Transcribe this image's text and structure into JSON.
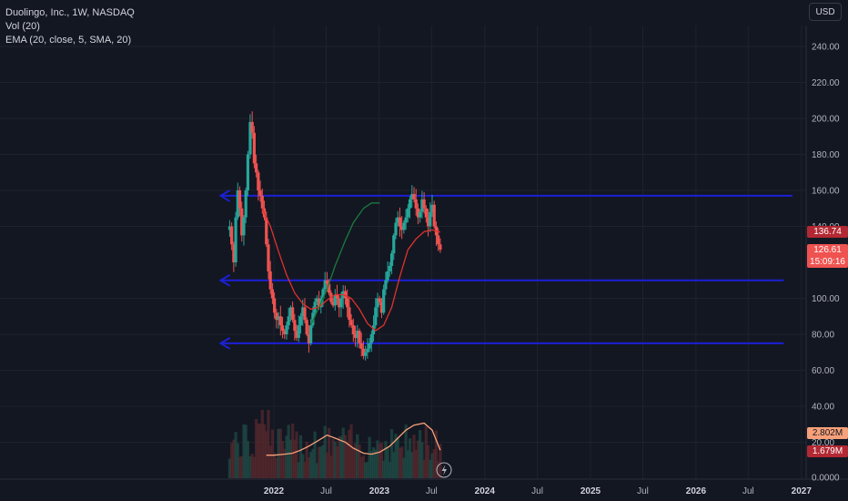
{
  "legend": {
    "symbol_line": "Duolingo, Inc., 1W, NASDAQ",
    "vol_line": "Vol (20)",
    "ema_line": "EMA (20, close, 5, SMA, 20)"
  },
  "currency": "USD",
  "tags": {
    "ema_value": "136.74",
    "last_price": "126.61",
    "countdown": "15:09:16",
    "vol_ma": "2.802M",
    "vol_last": "1.679M"
  },
  "colors": {
    "background": "#131722",
    "up": "#26a69a",
    "down": "#ef5350",
    "ema": "#e0322c",
    "ema_smoothed": "#1b7a3e",
    "vol_ma": "#f7a079",
    "hline": "#1c20d6"
  },
  "icons": [
    "lightning-icon"
  ],
  "chart_data": {
    "type": "candlestick",
    "price_axis": {
      "ticks": [
        240,
        220,
        200,
        180,
        160,
        140,
        100,
        80,
        60,
        40,
        20
      ],
      "tick_labels": [
        "240.00",
        "220.00",
        "200.00",
        "180.00",
        "160.00",
        "140.00",
        "100.00",
        "80.00",
        "60.00",
        "40.00",
        "20.00"
      ],
      "range": [
        0,
        250
      ]
    },
    "volume_axis": {
      "label": "0.0000",
      "value": 0
    },
    "time_axis": {
      "labels": [
        {
          "text": "2022",
          "date": "2022-01-01",
          "year": true
        },
        {
          "text": "Jul",
          "date": "2022-07-01",
          "year": false
        },
        {
          "text": "2023",
          "date": "2023-01-01",
          "year": true
        },
        {
          "text": "Jul",
          "date": "2023-07-01",
          "year": false
        },
        {
          "text": "2024",
          "date": "2024-01-01",
          "year": true
        },
        {
          "text": "Jul",
          "date": "2024-07-01",
          "year": false
        },
        {
          "text": "2025",
          "date": "2025-01-01",
          "year": true
        },
        {
          "text": "Jul",
          "date": "2025-07-01",
          "year": false
        },
        {
          "text": "2026",
          "date": "2026-01-01",
          "year": true
        },
        {
          "text": "Jul",
          "date": "2026-07-01",
          "year": false
        },
        {
          "text": "2027",
          "date": "2027-01-01",
          "year": true
        }
      ]
    },
    "horizontal_lines": [
      {
        "price": 157,
        "from": "2021-07-01",
        "to": "2026-12-01"
      },
      {
        "price": 110,
        "from": "2021-07-01",
        "to": "2026-11-01"
      },
      {
        "price": 75,
        "from": "2021-07-01",
        "to": "2026-11-01"
      }
    ],
    "segments": [
      {
        "start": "2021-08-01",
        "end": "2021-09-26",
        "values": [
          140,
          130,
          120,
          145,
          160,
          150,
          135,
          145,
          160
        ]
      },
      {
        "start": "2021-09-26",
        "end": "2021-10-25",
        "values": [
          160,
          180,
          198,
          192,
          175
        ]
      },
      {
        "start": "2021-10-25",
        "end": "2021-11-29",
        "values": [
          175,
          170,
          160,
          157,
          150,
          145
        ]
      },
      {
        "start": "2021-11-29",
        "end": "2022-03-07",
        "values": [
          145,
          130,
          115,
          105,
          100,
          92,
          88,
          90,
          85,
          82,
          80,
          85,
          90,
          95,
          88
        ]
      },
      {
        "start": "2022-03-07",
        "end": "2022-06-06",
        "values": [
          88,
          82,
          78,
          85,
          90,
          95,
          88,
          80,
          75,
          85,
          92,
          98,
          100,
          95
        ]
      },
      {
        "start": "2022-06-06",
        "end": "2022-09-05",
        "values": [
          95,
          100,
          105,
          110,
          108,
          103,
          98,
          96,
          102,
          100,
          95,
          100,
          104,
          100
        ]
      },
      {
        "start": "2022-09-05",
        "end": "2022-11-07",
        "values": [
          100,
          95,
          88,
          85,
          80,
          78,
          82,
          75,
          72,
          68
        ]
      },
      {
        "start": "2022-11-07",
        "end": "2023-02-06",
        "values": [
          68,
          70,
          72,
          75,
          80,
          85,
          95,
          100,
          98,
          92,
          105,
          110,
          115,
          118
        ]
      },
      {
        "start": "2023-02-06",
        "end": "2023-04-03",
        "values": [
          118,
          125,
          135,
          142,
          145,
          140,
          138,
          142,
          145
        ]
      },
      {
        "start": "2023-04-03",
        "end": "2023-06-05",
        "values": [
          145,
          150,
          155,
          158,
          155,
          150,
          145,
          148,
          155,
          150
        ]
      },
      {
        "start": "2023-06-05",
        "end": "2023-07-31",
        "values": [
          150,
          145,
          140,
          148,
          152,
          140,
          135,
          130,
          127
        ]
      }
    ],
    "ema_20": {
      "x": [
        "2021-11-22",
        "2021-12-20",
        "2022-01-17",
        "2022-02-14",
        "2022-03-14",
        "2022-04-11",
        "2022-05-09",
        "2022-06-06",
        "2022-07-04",
        "2022-08-01",
        "2022-08-29",
        "2022-09-26",
        "2022-10-24",
        "2022-11-21",
        "2022-12-19",
        "2023-01-16",
        "2023-02-13",
        "2023-03-13",
        "2023-04-10",
        "2023-05-08",
        "2023-06-05",
        "2023-07-03",
        "2023-07-31"
      ],
      "y": [
        150,
        140,
        126,
        113,
        103,
        97,
        94,
        95,
        99,
        102,
        102,
        100,
        94,
        86,
        82,
        85,
        95,
        112,
        127,
        133,
        137,
        138,
        136.74
      ]
    },
    "ema_smoothed": {
      "x": [
        "2022-05-09",
        "2022-06-06",
        "2022-07-04",
        "2022-08-01",
        "2022-09-05",
        "2022-10-03",
        "2022-11-07",
        "2022-12-05",
        "2023-01-02"
      ],
      "y": [
        85,
        95,
        105,
        118,
        132,
        142,
        150,
        153,
        153
      ]
    },
    "volume_ma_20": {
      "x": [
        "2021-12-06",
        "2022-01-03",
        "2022-02-07",
        "2022-03-07",
        "2022-04-04",
        "2022-05-02",
        "2022-06-06",
        "2022-07-04",
        "2022-08-01",
        "2022-09-05",
        "2022-10-03",
        "2022-11-07",
        "2022-12-05",
        "2023-01-02",
        "2023-02-06",
        "2023-03-06",
        "2023-04-03",
        "2023-05-01",
        "2023-06-05",
        "2023-07-03",
        "2023-07-31"
      ],
      "y": [
        2.3,
        2.3,
        2.4,
        2.5,
        2.8,
        3.2,
        3.8,
        4.3,
        4.0,
        3.6,
        3.0,
        2.5,
        2.4,
        2.6,
        3.2,
        4.0,
        4.8,
        5.3,
        5.5,
        4.8,
        2.802
      ]
    }
  }
}
